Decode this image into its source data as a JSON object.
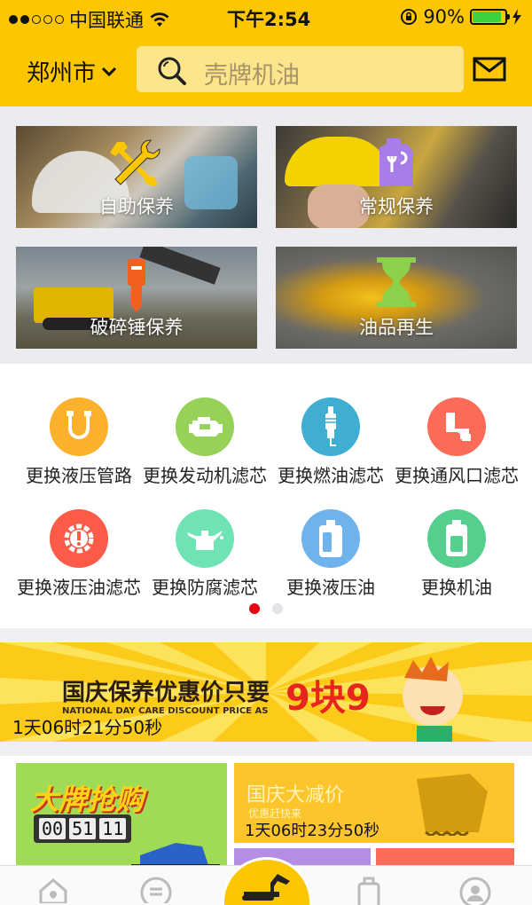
{
  "status_bar": {
    "carrier": "中国联通",
    "time": "下午2:54",
    "battery": "90%",
    "battery_level": 0.9
  },
  "header": {
    "city": "郑州市",
    "search_placeholder": "壳牌机油"
  },
  "services": [
    {
      "label": "自助保养",
      "icon": "wrench-screwdriver-icon",
      "color": "#fcc600"
    },
    {
      "label": "常规保养",
      "icon": "oil-can-icon",
      "color": "#a77ee8"
    },
    {
      "label": "破碎锤保养",
      "icon": "hammer-icon",
      "color": "#f2601e"
    },
    {
      "label": "油品再生",
      "icon": "hourglass-icon",
      "color": "#8cd14a"
    }
  ],
  "grid_items": [
    {
      "label": "更换液压管路",
      "icon": "hose-icon",
      "color": "#fbb12c"
    },
    {
      "label": "更换发动机滤芯",
      "icon": "engine-icon",
      "color": "#96d257"
    },
    {
      "label": "更换燃油滤芯",
      "icon": "spark-plug-icon",
      "color": "#3faed2"
    },
    {
      "label": "更换通风口滤芯",
      "icon": "pipe-icon",
      "color": "#fc6b57"
    },
    {
      "label": "更换液压油滤芯",
      "icon": "gear-alert-icon",
      "color": "#fc5c47"
    },
    {
      "label": "更换防腐滤芯",
      "icon": "oil-pot-icon",
      "color": "#6fe3b4"
    },
    {
      "label": "更换液压油",
      "icon": "bottle-icon",
      "color": "#6fb3ec"
    },
    {
      "label": "更换机油",
      "icon": "battery-jug-icon",
      "color": "#54cf8e"
    }
  ],
  "pager": {
    "count": 2,
    "active": 0
  },
  "banner": {
    "title": "国庆保养优惠价只要",
    "subtitle": "NATIONAL DAY CARE DISCOUNT PRICE AS",
    "price": "9块9",
    "countdown": "1天06时21分50秒"
  },
  "promo_left": {
    "title": "大牌抢购",
    "countdown_digits": [
      "00",
      "51",
      "11"
    ]
  },
  "promo_right": {
    "title": "国庆大减价",
    "subtitle": "优惠赶快来",
    "countdown": "1天06时23分50秒"
  },
  "tabs": [
    {
      "icon": "home-icon"
    },
    {
      "icon": "message-icon"
    },
    {
      "icon": "excavator-icon"
    },
    {
      "icon": "oil-bottle-icon"
    },
    {
      "icon": "profile-icon"
    }
  ]
}
